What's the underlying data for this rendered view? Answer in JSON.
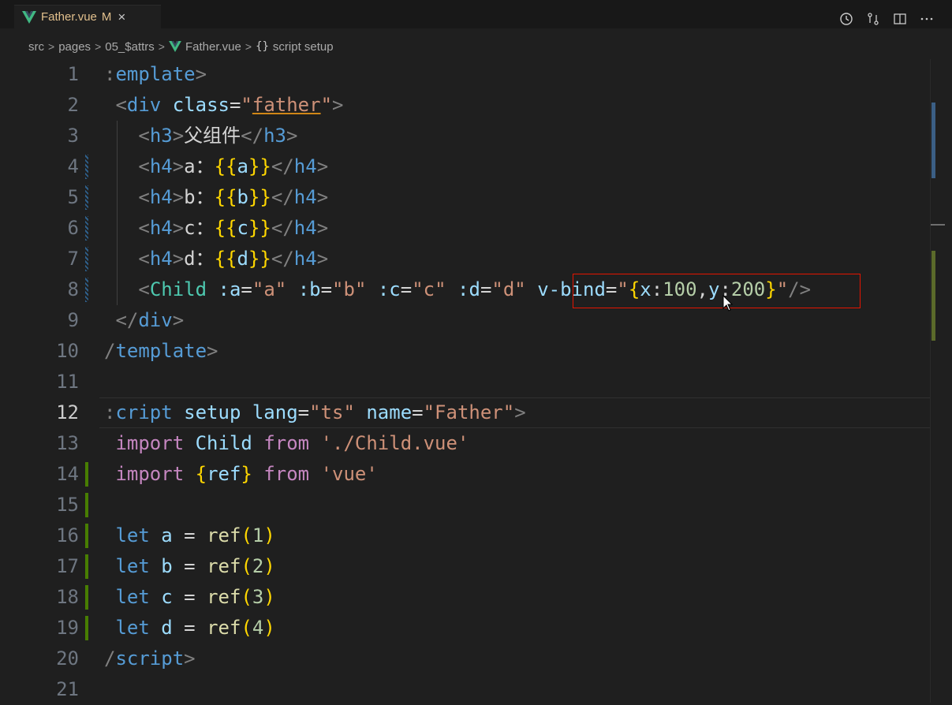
{
  "tab": {
    "filename": "Father.vue",
    "modified_badge": "M",
    "close_glyph": "×"
  },
  "editor_actions": [
    "history-icon",
    "source-control-compare-icon",
    "split-editor-icon",
    "more-actions-icon"
  ],
  "breadcrumb": {
    "items": [
      "src",
      "pages",
      "05_$attrs",
      "Father.vue",
      "script setup"
    ],
    "separator": ">",
    "symbol_icon": "{}"
  },
  "lines": [
    {
      "n": "1",
      "t": [
        [
          "punc",
          ":"
        ],
        [
          "tag",
          "emplate"
        ],
        [
          "punc",
          ">"
        ]
      ]
    },
    {
      "n": "2",
      "t": [
        [
          "plain",
          " "
        ],
        [
          "punc",
          "<"
        ],
        [
          "tag",
          "div"
        ],
        [
          "plain",
          " "
        ],
        [
          "attr",
          "class"
        ],
        [
          "plain",
          "="
        ],
        [
          "str",
          "\""
        ],
        [
          "str-u",
          "father"
        ],
        [
          "str",
          "\""
        ],
        [
          "punc",
          ">"
        ]
      ]
    },
    {
      "n": "3",
      "t": [
        [
          "plain",
          "   "
        ],
        [
          "punc",
          "<"
        ],
        [
          "tag",
          "h3"
        ],
        [
          "punc",
          ">"
        ],
        [
          "plain",
          "父组件"
        ],
        [
          "punc",
          "</"
        ],
        [
          "tag",
          "h3"
        ],
        [
          "punc",
          ">"
        ]
      ]
    },
    {
      "n": "4",
      "t": [
        [
          "plain",
          "   "
        ],
        [
          "punc",
          "<"
        ],
        [
          "tag",
          "h4"
        ],
        [
          "punc",
          ">"
        ],
        [
          "plain",
          "a："
        ],
        [
          "brace",
          "{{"
        ],
        [
          "var",
          "a"
        ],
        [
          "brace",
          "}}"
        ],
        [
          "punc",
          "</"
        ],
        [
          "tag",
          "h4"
        ],
        [
          "punc",
          ">"
        ]
      ]
    },
    {
      "n": "5",
      "t": [
        [
          "plain",
          "   "
        ],
        [
          "punc",
          "<"
        ],
        [
          "tag",
          "h4"
        ],
        [
          "punc",
          ">"
        ],
        [
          "plain",
          "b："
        ],
        [
          "brace",
          "{{"
        ],
        [
          "var",
          "b"
        ],
        [
          "brace",
          "}}"
        ],
        [
          "punc",
          "</"
        ],
        [
          "tag",
          "h4"
        ],
        [
          "punc",
          ">"
        ]
      ]
    },
    {
      "n": "6",
      "t": [
        [
          "plain",
          "   "
        ],
        [
          "punc",
          "<"
        ],
        [
          "tag",
          "h4"
        ],
        [
          "punc",
          ">"
        ],
        [
          "plain",
          "c："
        ],
        [
          "brace",
          "{{"
        ],
        [
          "var",
          "c"
        ],
        [
          "brace",
          "}}"
        ],
        [
          "punc",
          "</"
        ],
        [
          "tag",
          "h4"
        ],
        [
          "punc",
          ">"
        ]
      ]
    },
    {
      "n": "7",
      "t": [
        [
          "plain",
          "   "
        ],
        [
          "punc",
          "<"
        ],
        [
          "tag",
          "h4"
        ],
        [
          "punc",
          ">"
        ],
        [
          "plain",
          "d："
        ],
        [
          "brace",
          "{{"
        ],
        [
          "var",
          "d"
        ],
        [
          "brace",
          "}}"
        ],
        [
          "punc",
          "</"
        ],
        [
          "tag",
          "h4"
        ],
        [
          "punc",
          ">"
        ]
      ]
    },
    {
      "n": "8",
      "t": [
        [
          "plain",
          "   "
        ],
        [
          "punc",
          "<"
        ],
        [
          "comp",
          "Child"
        ],
        [
          "plain",
          " "
        ],
        [
          "attr",
          ":a"
        ],
        [
          "plain",
          "="
        ],
        [
          "str",
          "\"a\""
        ],
        [
          "plain",
          " "
        ],
        [
          "attr",
          ":b"
        ],
        [
          "plain",
          "="
        ],
        [
          "str",
          "\"b\""
        ],
        [
          "plain",
          " "
        ],
        [
          "attr",
          ":c"
        ],
        [
          "plain",
          "="
        ],
        [
          "str",
          "\"c\""
        ],
        [
          "plain",
          " "
        ],
        [
          "attr",
          ":d"
        ],
        [
          "plain",
          "="
        ],
        [
          "str",
          "\"d\""
        ],
        [
          "plain",
          " "
        ],
        [
          "attr",
          "v-bind"
        ],
        [
          "plain",
          "="
        ],
        [
          "str",
          "\""
        ],
        [
          "brace",
          "{"
        ],
        [
          "var",
          "x"
        ],
        [
          "plain",
          ":"
        ],
        [
          "num",
          "100"
        ],
        [
          "plain",
          ","
        ],
        [
          "var",
          "y"
        ],
        [
          "plain",
          ":"
        ],
        [
          "num",
          "200"
        ],
        [
          "brace",
          "}"
        ],
        [
          "str",
          "\""
        ],
        [
          "punc",
          "/>"
        ]
      ]
    },
    {
      "n": "9",
      "t": [
        [
          "plain",
          " "
        ],
        [
          "punc",
          "</"
        ],
        [
          "tag",
          "div"
        ],
        [
          "punc",
          ">"
        ]
      ]
    },
    {
      "n": "10",
      "t": [
        [
          "punc",
          "/"
        ],
        [
          "tag",
          "template"
        ],
        [
          "punc",
          ">"
        ]
      ]
    },
    {
      "n": "11",
      "t": []
    },
    {
      "n": "12",
      "t": [
        [
          "punc",
          ":"
        ],
        [
          "tag",
          "cript"
        ],
        [
          "plain",
          " "
        ],
        [
          "attr",
          "setup"
        ],
        [
          "plain",
          " "
        ],
        [
          "attr",
          "lang"
        ],
        [
          "plain",
          "="
        ],
        [
          "str",
          "\"ts\""
        ],
        [
          "plain",
          " "
        ],
        [
          "attr",
          "name"
        ],
        [
          "plain",
          "="
        ],
        [
          "str",
          "\"Father\""
        ],
        [
          "punc",
          ">"
        ]
      ]
    },
    {
      "n": "13",
      "t": [
        [
          "plain",
          " "
        ],
        [
          "imp",
          "import"
        ],
        [
          "plain",
          " "
        ],
        [
          "var",
          "Child"
        ],
        [
          "plain",
          " "
        ],
        [
          "imp",
          "from"
        ],
        [
          "plain",
          " "
        ],
        [
          "str",
          "'./Child.vue'"
        ]
      ]
    },
    {
      "n": "14",
      "t": [
        [
          "plain",
          " "
        ],
        [
          "imp",
          "import"
        ],
        [
          "plain",
          " "
        ],
        [
          "brace",
          "{"
        ],
        [
          "var",
          "ref"
        ],
        [
          "brace",
          "}"
        ],
        [
          "plain",
          " "
        ],
        [
          "imp",
          "from"
        ],
        [
          "plain",
          " "
        ],
        [
          "str",
          "'vue'"
        ]
      ]
    },
    {
      "n": "15",
      "t": []
    },
    {
      "n": "16",
      "t": [
        [
          "plain",
          " "
        ],
        [
          "kw",
          "let"
        ],
        [
          "plain",
          " "
        ],
        [
          "var",
          "a"
        ],
        [
          "plain",
          " = "
        ],
        [
          "fn",
          "ref"
        ],
        [
          "brace",
          "("
        ],
        [
          "num",
          "1"
        ],
        [
          "brace",
          ")"
        ]
      ]
    },
    {
      "n": "17",
      "t": [
        [
          "plain",
          " "
        ],
        [
          "kw",
          "let"
        ],
        [
          "plain",
          " "
        ],
        [
          "var",
          "b"
        ],
        [
          "plain",
          " = "
        ],
        [
          "fn",
          "ref"
        ],
        [
          "brace",
          "("
        ],
        [
          "num",
          "2"
        ],
        [
          "brace",
          ")"
        ]
      ]
    },
    {
      "n": "18",
      "t": [
        [
          "plain",
          " "
        ],
        [
          "kw",
          "let"
        ],
        [
          "plain",
          " "
        ],
        [
          "var",
          "c"
        ],
        [
          "plain",
          " = "
        ],
        [
          "fn",
          "ref"
        ],
        [
          "brace",
          "("
        ],
        [
          "num",
          "3"
        ],
        [
          "brace",
          ")"
        ]
      ]
    },
    {
      "n": "19",
      "t": [
        [
          "plain",
          " "
        ],
        [
          "kw",
          "let"
        ],
        [
          "plain",
          " "
        ],
        [
          "var",
          "d"
        ],
        [
          "plain",
          " = "
        ],
        [
          "fn",
          "ref"
        ],
        [
          "brace",
          "("
        ],
        [
          "num",
          "4"
        ],
        [
          "brace",
          ")"
        ]
      ]
    },
    {
      "n": "20",
      "t": [
        [
          "punc",
          "/"
        ],
        [
          "tag",
          "script"
        ],
        [
          "punc",
          ">"
        ]
      ]
    },
    {
      "n": "21",
      "t": []
    }
  ],
  "active_line": "12",
  "modified_lines": [
    "4",
    "5",
    "6",
    "7",
    "8"
  ],
  "added_lines": [
    "14",
    "15",
    "16",
    "17",
    "18",
    "19"
  ],
  "colors": {
    "editor_bg": "#1f1f1f",
    "tag": "#569cd6",
    "attribute": "#9cdcfe",
    "string": "#ce9178",
    "keyword_import": "#c586c0",
    "number": "#b5cea8",
    "function": "#dcdcaa",
    "bracket": "#ffd700",
    "component": "#4ec9b0",
    "highlight_box": "#e51400",
    "tab_modified": "#e2c08d"
  }
}
